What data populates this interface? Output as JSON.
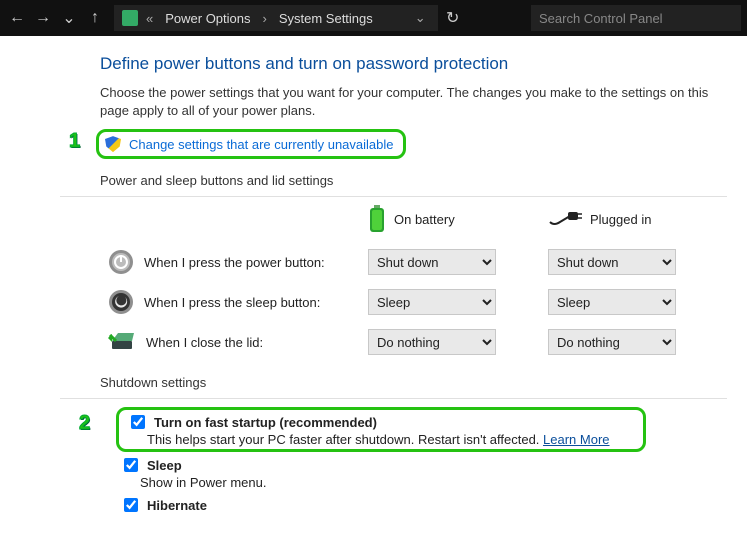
{
  "nav": {
    "breadcrumb_prefix": "«",
    "crumb1": "Power Options",
    "crumb2": "System Settings",
    "search_placeholder": "Search Control Panel"
  },
  "page": {
    "heading": "Define power buttons and turn on password protection",
    "intro": "Choose the power settings that you want for your computer. The changes you make to the settings on this page apply to all of your power plans.",
    "change_link": "Change settings that are currently unavailable"
  },
  "annotations": {
    "one": "1",
    "two": "2"
  },
  "buttons_section": {
    "title": "Power and sleep buttons and lid settings",
    "col_battery": "On battery",
    "col_plugged": "Plugged in",
    "rows": [
      {
        "label": "When I press the power button:",
        "bat": "Shut down",
        "ac": "Shut down"
      },
      {
        "label": "When I press the sleep button:",
        "bat": "Sleep",
        "ac": "Sleep"
      },
      {
        "label": "When I close the lid:",
        "bat": "Do nothing",
        "ac": "Do nothing"
      }
    ]
  },
  "shutdown_section": {
    "title": "Shutdown settings",
    "items": [
      {
        "checked": true,
        "label": "Turn on fast startup (recommended)",
        "desc": "This helps start your PC faster after shutdown. Restart isn't affected. ",
        "link": "Learn More"
      },
      {
        "checked": true,
        "label": "Sleep",
        "desc": "Show in Power menu."
      },
      {
        "checked": true,
        "label": "Hibernate",
        "desc": ""
      }
    ]
  }
}
